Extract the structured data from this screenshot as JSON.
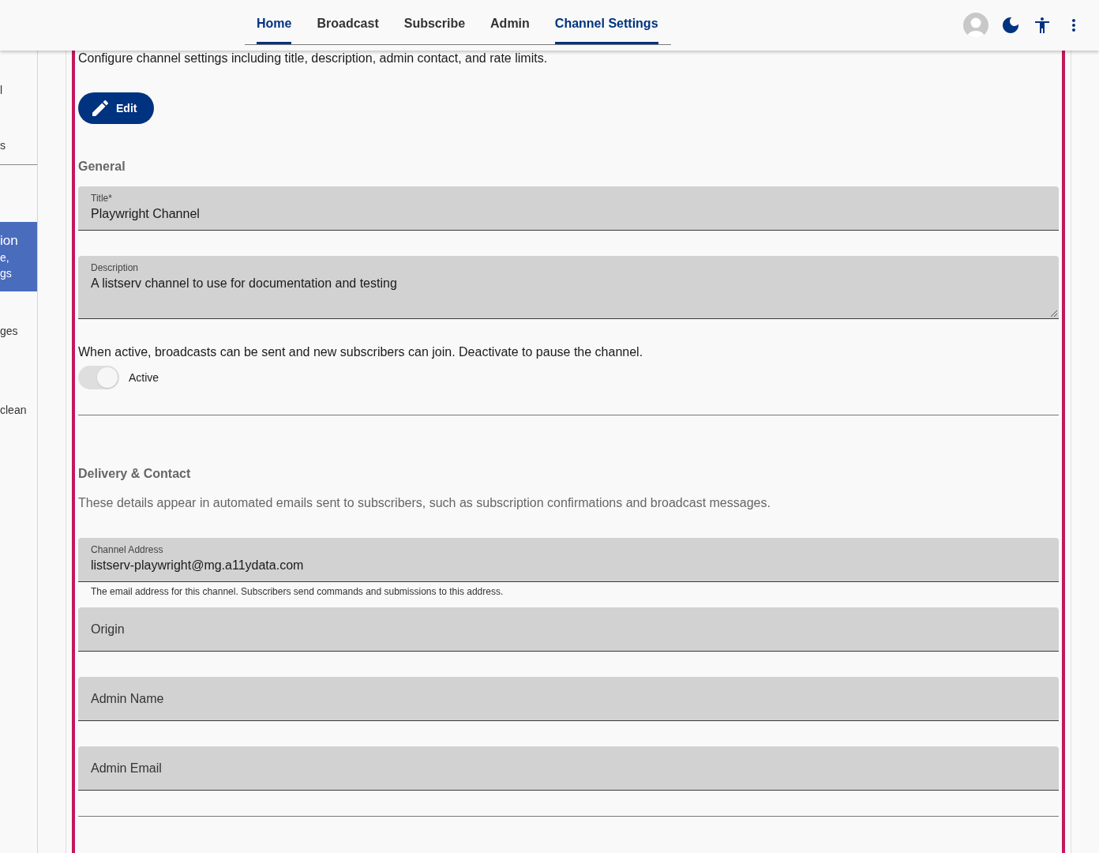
{
  "nav": {
    "tabs": [
      {
        "label": "Home",
        "selected": true
      },
      {
        "label": "Broadcast",
        "selected": false
      },
      {
        "label": "Subscribe",
        "selected": false
      },
      {
        "label": "Admin",
        "selected": false
      },
      {
        "label": "Channel Settings",
        "selected": true
      }
    ]
  },
  "sidebar": {
    "groups": [
      [
        {
          "title": "l",
          "selected": false
        },
        {
          "title": "s",
          "selected": false
        }
      ],
      [
        {
          "title": "ion",
          "subtitle_lines": [
            "e,",
            "gs"
          ],
          "selected": true
        },
        {
          "title": "ges",
          "selected": false
        },
        {
          "title": "clean",
          "selected": false
        }
      ]
    ]
  },
  "page": {
    "intro": "Configure channel settings including title, description, admin contact, and rate limits.",
    "edit_button": "Edit"
  },
  "sections": [
    {
      "heading": "General",
      "items": [
        {
          "kind": "field",
          "label": "Title*",
          "value": "Playwright Channel"
        },
        {
          "kind": "textarea",
          "label": "Description",
          "value": "A listserv channel to use for documentation and testing"
        },
        {
          "kind": "switch",
          "note": "When active, broadcasts can be sent and new subscribers can join. Deactivate to pause the channel.",
          "label": "Active",
          "on": true,
          "disabled": true
        }
      ]
    },
    {
      "heading": "Delivery & Contact",
      "intro": "These details appear in automated emails sent to subscribers, such as subscription confirmations and broadcast messages.",
      "items": [
        {
          "kind": "field",
          "label": "Channel Address",
          "value": "listserv-playwright@mg.a11ydata.com",
          "helper": "The email address for this channel. Subscribers send commands and submissions to this address."
        },
        {
          "kind": "field",
          "label": "Origin"
        },
        {
          "kind": "field",
          "label": "Admin Name"
        },
        {
          "kind": "field",
          "label": "Admin Email"
        }
      ]
    }
  ]
}
